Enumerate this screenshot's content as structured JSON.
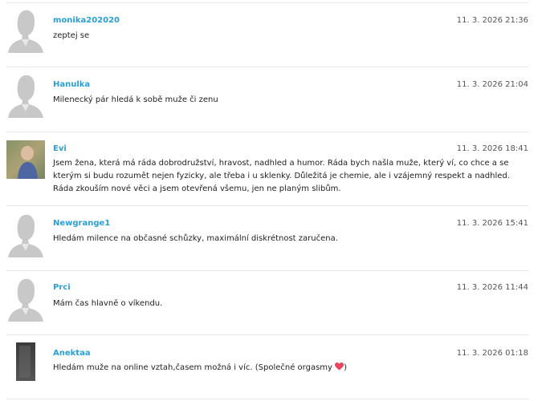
{
  "posts": [
    {
      "author": "monika202020",
      "time": "11. 3. 2026 21:36",
      "text": "zeptej se",
      "avatar": "default-silhouette-icon"
    },
    {
      "author": "Hanulka",
      "time": "11. 3. 2026 21:04",
      "text": "Milenecký pár hledá k sobě muže či zenu",
      "avatar": "default-silhouette-icon"
    },
    {
      "author": "Evi",
      "time": "11. 3. 2026 18:41",
      "text": "Jsem žena, která má ráda dobrodružství, hravost, nadhled a humor. Ráda bych našla muže, který ví, co chce a se kterým si budu rozumět nejen fyzicky, ale třeba i u sklenky. Důležitá je chemie, ale i vzájemný respekt a nadhled. Ráda zkouším nové věci a jsem otevřená všemu, jen ne planým slibům.",
      "avatar": "user-photo"
    },
    {
      "author": "Newgrange1",
      "time": "11. 3. 2026 15:41",
      "text": "Hledám milence na občasné schůzky, maximální diskrétnost zaručena.",
      "avatar": "default-silhouette-icon"
    },
    {
      "author": "Prci",
      "time": "11. 3. 2026 11:44",
      "text": "Mám čas hlavně o víkendu.",
      "avatar": "default-silhouette-icon"
    },
    {
      "author": "Anektaa",
      "time": "11. 3. 2026 01:18",
      "text": "Hledám muže na online vztah,časem možná i víc. (Společné orgasmy",
      "text_end": ")",
      "avatar": "user-photo",
      "emoji": "heart-icon"
    }
  ],
  "colors": {
    "author": "#2a9fd6",
    "divider": "#e6e6e6",
    "heart": "#e8475f"
  }
}
